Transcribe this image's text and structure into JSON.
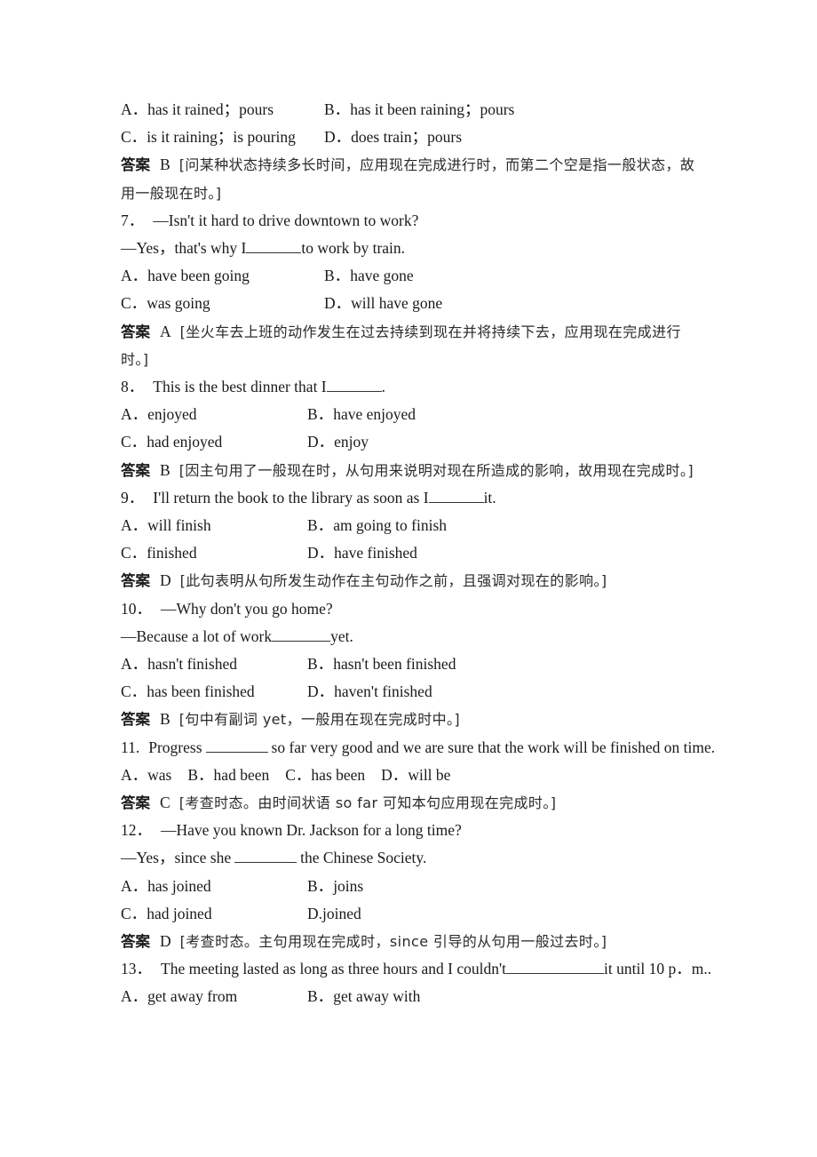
{
  "page": {
    "doc_type": "english-grammar-exercise-answer-key",
    "language_mix": "english-chinese"
  },
  "labels": {
    "answer": "答案",
    "dash": "—",
    "open_bracket": "[",
    "close_bracket": "]"
  },
  "q6_tail": {
    "options": [
      {
        "letter": "A．",
        "text": "has it rained；pours"
      },
      {
        "letter": "B．",
        "text": "has it been raining；pours"
      },
      {
        "letter": "C．",
        "text": "is it raining；is pouring"
      },
      {
        "letter": "D．",
        "text": "does train；pours"
      }
    ],
    "answer_letter": "B",
    "explanation": "[问某种状态持续多长时间，应用现在完成进行时，而第二个空是指一般状态，故用一般现在时。]"
  },
  "questions": [
    {
      "number": "7．",
      "stem_line1": "—Isn't it hard to drive downtown to work?",
      "stem_line2_pre": "—Yes，that's why I",
      "stem_line2_post": "to work by train.",
      "options": [
        {
          "letter": "A．",
          "text": "have been going"
        },
        {
          "letter": "B．",
          "text": "have gone"
        },
        {
          "letter": "C．",
          "text": "was going"
        },
        {
          "letter": "D．",
          "text": "will have gone"
        }
      ],
      "answer_letter": "A",
      "explanation": "[坐火车去上班的动作发生在过去持续到现在并将持续下去，应用现在完成进行时。]"
    },
    {
      "number": "8．",
      "stem_line1_pre": "This is the best dinner that I",
      "stem_line1_post": ".",
      "options": [
        {
          "letter": "A．",
          "text": "enjoyed"
        },
        {
          "letter": "B．",
          "text": "have enjoyed"
        },
        {
          "letter": "C．",
          "text": "had enjoyed"
        },
        {
          "letter": "D．",
          "text": "enjoy"
        }
      ],
      "answer_letter": "B",
      "explanation": "[因主句用了一般现在时，从句用来说明对现在所造成的影响，故用现在完成时。]"
    },
    {
      "number": "9．",
      "stem_line1_pre": "I'll return the book to the library as soon as I",
      "stem_line1_post": "it.",
      "options": [
        {
          "letter": "A．",
          "text": "will finish"
        },
        {
          "letter": "B．",
          "text": "am going to finish"
        },
        {
          "letter": "C．",
          "text": "finished"
        },
        {
          "letter": "D．",
          "text": "have finished"
        }
      ],
      "answer_letter": "D",
      "explanation": "[此句表明从句所发生动作在主句动作之前，且强调对现在的影响。]"
    },
    {
      "number": "10．",
      "stem_line1": "—Why don't you go home?",
      "stem_line2_pre": "—Because a lot of work",
      "stem_line2_post": "yet.",
      "options": [
        {
          "letter": "A．",
          "text": "hasn't finished"
        },
        {
          "letter": "B．",
          "text": "hasn't been finished"
        },
        {
          "letter": "C．",
          "text": "has been finished"
        },
        {
          "letter": "D．",
          "text": "haven't finished"
        }
      ],
      "answer_letter": "B",
      "explanation": "[句中有副词 yet，一般用在现在完成时中。]"
    },
    {
      "number": "11.",
      "stem_line1_pre": "Progress",
      "stem_line1_post": "so far very good and   we are sure that the work will be finished on time.",
      "options_inline": [
        {
          "letter": "A．",
          "text": "was"
        },
        {
          "letter": "B．",
          "text": "had been"
        },
        {
          "letter": "C．",
          "text": "has been"
        },
        {
          "letter": "D．",
          "text": "will be"
        }
      ],
      "answer_letter": "C",
      "explanation": "[考查时态。由时间状语 so far 可知本句应用现在完成时。]"
    },
    {
      "number": "12．",
      "stem_line1": "—Have you known Dr. Jackson for a long time?",
      "stem_line2_pre": "—Yes，since she",
      "stem_line2_post": "the Chinese   Society.",
      "options": [
        {
          "letter": "A．",
          "text": "has joined"
        },
        {
          "letter": "B．",
          "text": "joins"
        },
        {
          "letter": "C．",
          "text": "had joined"
        },
        {
          "letter": "D.",
          "text": "joined"
        }
      ],
      "answer_letter": "D",
      "explanation": "[考查时态。主句用现在完成时，since 引导的从句用一般过去时。]"
    },
    {
      "number": "13．",
      "stem_line1_pre": "The meeting lasted as long as three hours and I couldn't",
      "stem_line1_post": "it until 10   p．m..",
      "options": [
        {
          "letter": "A．",
          "text": "get away from"
        },
        {
          "letter": "B．",
          "text": "get away with"
        }
      ]
    }
  ]
}
